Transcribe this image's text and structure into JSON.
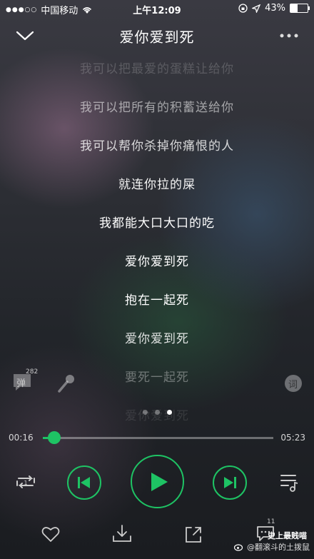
{
  "status_bar": {
    "carrier": "中国移动",
    "time": "上午12:09",
    "battery": "43%",
    "battery_level": 0.43
  },
  "header": {
    "title": "爱你爱到死"
  },
  "lyrics": [
    {
      "text": "我可以把最爱的蛋糕让给你",
      "opacity": 0.18
    },
    {
      "text": "我可以把所有的积蓄送给你",
      "opacity": 0.55
    },
    {
      "text": "我可以帮你杀掉你痛恨的人",
      "opacity": 0.8
    },
    {
      "text": "就连你拉的屎",
      "opacity": 0.95
    },
    {
      "text": "我都能大口大口的吃",
      "opacity": 1
    },
    {
      "text": "爱你爱到死",
      "opacity": 1
    },
    {
      "text": "抱在一起死",
      "opacity": 1
    },
    {
      "text": "爱你爱到死",
      "opacity": 0.85
    },
    {
      "text": "要死一起死",
      "opacity": 0.35
    },
    {
      "text": "爱你爱到死",
      "opacity": 0.1
    }
  ],
  "side": {
    "danmu_label": "弹",
    "danmu_count": "282",
    "lyrics_label": "词"
  },
  "pager": {
    "count": 3,
    "active": 2
  },
  "player": {
    "current_time": "00:16",
    "total_time": "05:23",
    "progress": 0.05
  },
  "bottom": {
    "comment_count": "11"
  },
  "watermark": {
    "line1": "史上最贱喵",
    "line2": "@翻滚斗的土拨鼠"
  },
  "colors": {
    "accent": "#1ec364"
  }
}
